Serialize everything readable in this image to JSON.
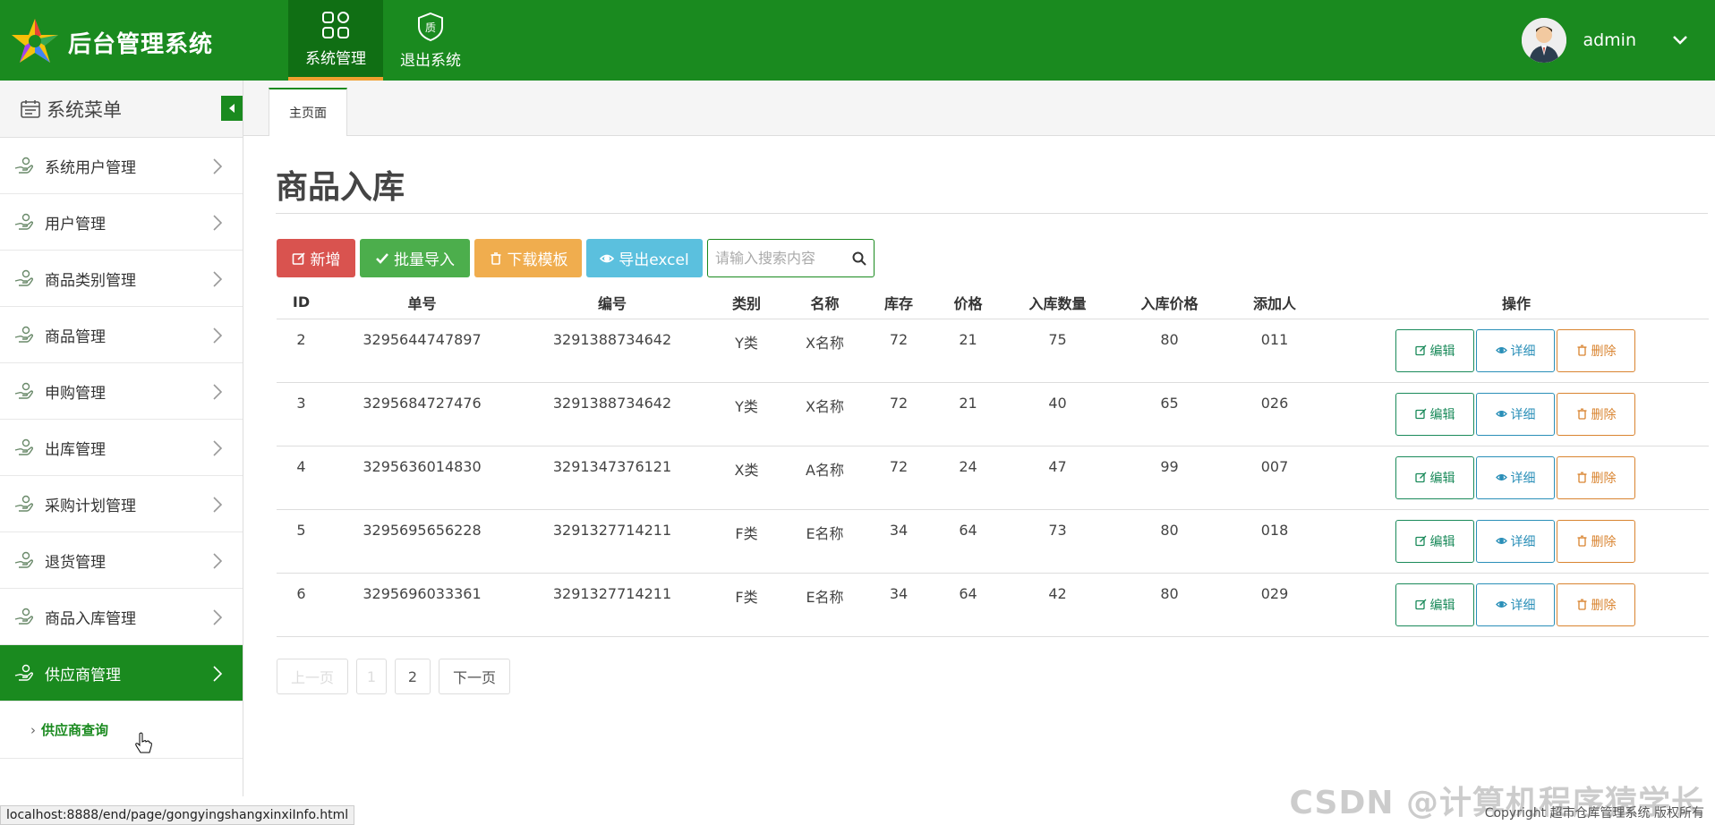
{
  "header": {
    "app_title": "后台管理系统",
    "nav": [
      {
        "label": "系统管理",
        "icon": "grid-icon",
        "active": true
      },
      {
        "label": "退出系统",
        "icon": "shield-exit-icon",
        "active": false
      }
    ],
    "username": "admin",
    "accent": "#1a8a1f"
  },
  "sidebar": {
    "title": "系统菜单",
    "items": [
      {
        "label": "系统用户管理"
      },
      {
        "label": "用户管理"
      },
      {
        "label": "商品类别管理"
      },
      {
        "label": "商品管理"
      },
      {
        "label": "申购管理"
      },
      {
        "label": "出库管理"
      },
      {
        "label": "采购计划管理"
      },
      {
        "label": "退货管理"
      },
      {
        "label": "商品入库管理"
      },
      {
        "label": "供应商管理",
        "active": true
      }
    ],
    "submenu": [
      {
        "label": "供应商查询"
      }
    ]
  },
  "tabs": [
    {
      "label": "主页面",
      "active": true
    }
  ],
  "main": {
    "title": "商品入库",
    "toolbar": {
      "add": "新增",
      "import": "批量导入",
      "template": "下载模板",
      "export": "导出excel",
      "search_placeholder": "请输入搜索内容"
    },
    "table": {
      "headers": [
        "ID",
        "单号",
        "编号",
        "类别",
        "名称",
        "库存",
        "价格",
        "入库数量",
        "入库价格",
        "添加人",
        "操作"
      ],
      "rows": [
        [
          "2",
          "3295644747897",
          "3291388734642",
          "Y类",
          "X名称",
          "72",
          "21",
          "75",
          "80",
          "011"
        ],
        [
          "3",
          "3295684727476",
          "3291388734642",
          "Y类",
          "X名称",
          "72",
          "21",
          "40",
          "65",
          "026"
        ],
        [
          "4",
          "3295636014830",
          "3291347376121",
          "X类",
          "A名称",
          "72",
          "24",
          "47",
          "99",
          "007"
        ],
        [
          "5",
          "3295695656228",
          "3291327714211",
          "F类",
          "E名称",
          "34",
          "64",
          "73",
          "80",
          "018"
        ],
        [
          "6",
          "3295696033361",
          "3291327714211",
          "F类",
          "E名称",
          "34",
          "64",
          "42",
          "80",
          "029"
        ]
      ],
      "ops": {
        "edit": "编辑",
        "detail": "详细",
        "delete": "删除"
      }
    },
    "pager": {
      "prev": "上一页",
      "pages": [
        "1",
        "2"
      ],
      "next": "下一页"
    }
  },
  "status_url": "localhost:8888/end/page/gongyingshangxinxiInfo.html",
  "footer": "Copyright 超市仓库管理系统 版权所有",
  "watermark": "CSDN @计算机程序猿学长"
}
